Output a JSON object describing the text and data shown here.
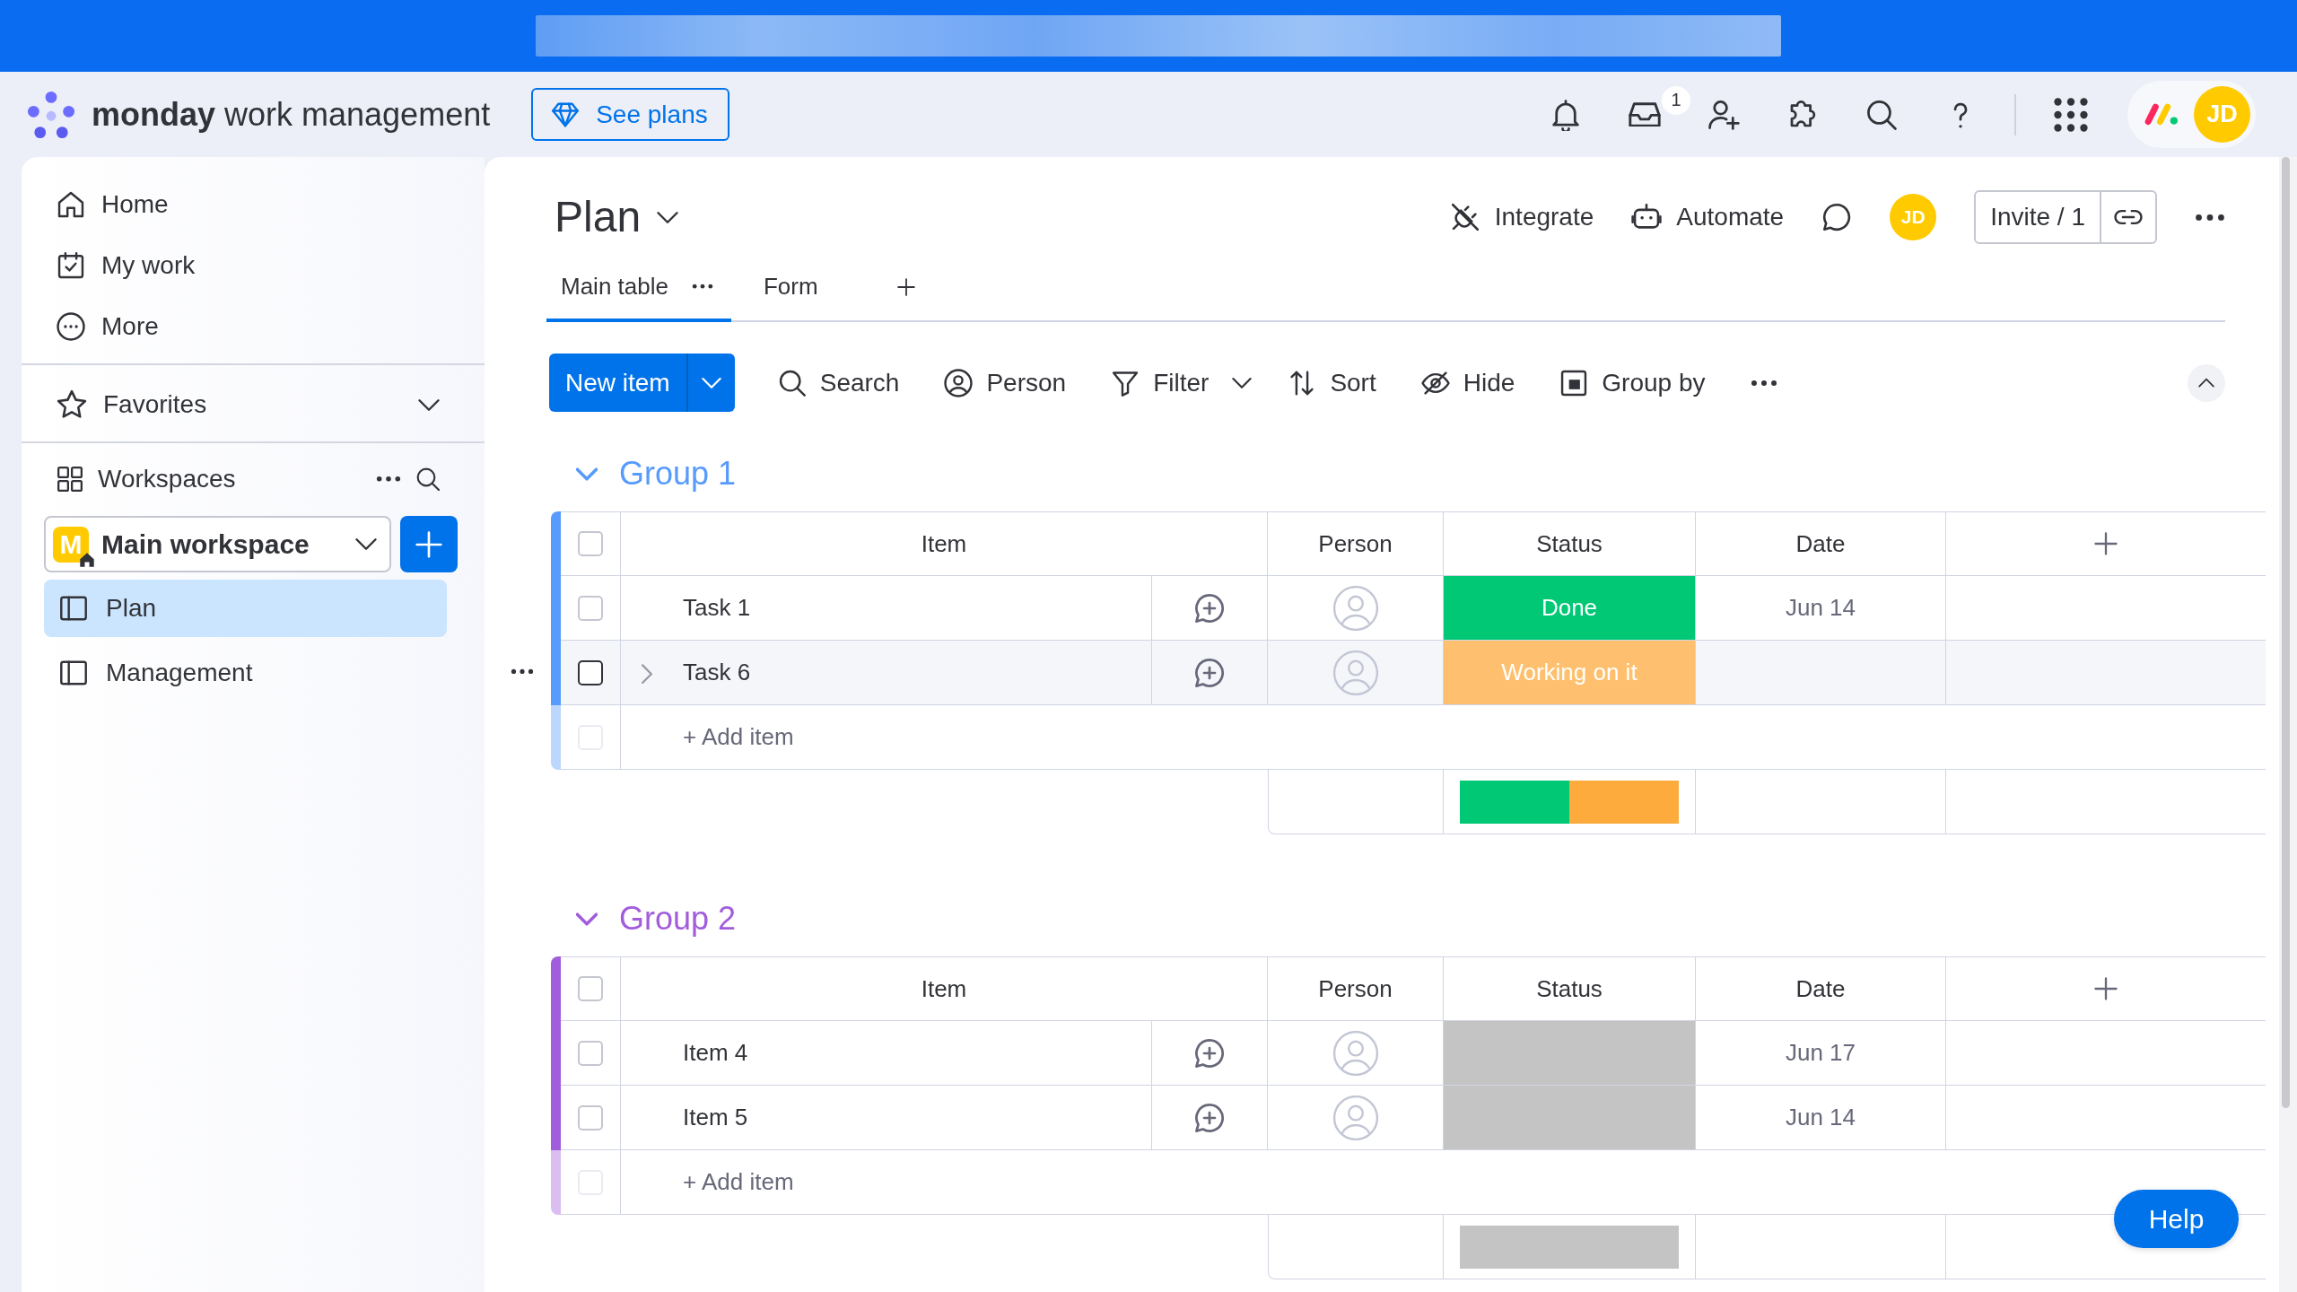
{
  "top_bar": {
    "brand": "**monday** work management",
    "see_plans_button": "See plans",
    "inbox_badge": "1",
    "avatar": "JD"
  },
  "sidebar": {
    "nav_items": [
      "Home",
      "My work",
      "More"
    ],
    "favorites": {
      "label": "Favorites",
      "expanded": false
    },
    "workspaces": {
      "label": "Workspaces"
    },
    "workspace_picker": {
      "badge": "M",
      "value": "Main workspace"
    },
    "boards": [
      {
        "label": "Plan",
        "selected": true
      },
      {
        "label": "Management",
        "selected": false
      }
    ]
  },
  "board": {
    "title": "Plan",
    "actions": [
      "Integrate",
      "Automate"
    ],
    "avatar": "JD",
    "invite_button": "Invite / 1",
    "views": [
      {
        "label": "Main table",
        "selected": true
      },
      {
        "label": "Form",
        "selected": false
      }
    ],
    "toolbar": {
      "new_item_button": "New item",
      "tools": [
        {
          "label": "Search",
          "dropdown": false
        },
        {
          "label": "Person",
          "dropdown": false
        },
        {
          "label": "Filter",
          "dropdown": true
        },
        {
          "label": "Sort",
          "dropdown": false
        },
        {
          "label": "Hide",
          "dropdown": false
        },
        {
          "label": "Group by",
          "dropdown": false
        }
      ]
    },
    "groups": [
      {
        "title": "Group 1",
        "color": "#579bfc",
        "expanded": true,
        "select_all_checked": false,
        "columns": [
          "Item",
          "Person",
          "Status",
          "Date"
        ],
        "rows": [
          {
            "name": "Task 1",
            "checked": false,
            "hovered": false,
            "status": {
              "label": "Done",
              "color": "#00c875"
            },
            "date": "Jun 14"
          },
          {
            "name": "Task 6",
            "checked": false,
            "hovered": true,
            "status": {
              "label": "Working on it",
              "color": "#fdab3d"
            }
          }
        ],
        "add_row": {
          "placeholder": "+ Add item",
          "checkbox_disabled": true
        }
      },
      {
        "title": "Group 2",
        "color": "#a25ddc",
        "expanded": true,
        "select_all_checked": false,
        "columns": [
          "Item",
          "Person",
          "Status",
          "Date"
        ],
        "rows": [
          {
            "name": "Item 4",
            "checked": false,
            "hovered": false,
            "status": {
              "color": "#c4c4c4"
            },
            "date": "Jun 17"
          },
          {
            "name": "Item 5",
            "checked": false,
            "hovered": false,
            "status": {
              "color": "#c4c4c4"
            },
            "date": "Jun 14"
          }
        ],
        "add_row": {
          "placeholder": "+ Add item",
          "checkbox_disabled": true
        }
      }
    ]
  },
  "help_button": "Help"
}
